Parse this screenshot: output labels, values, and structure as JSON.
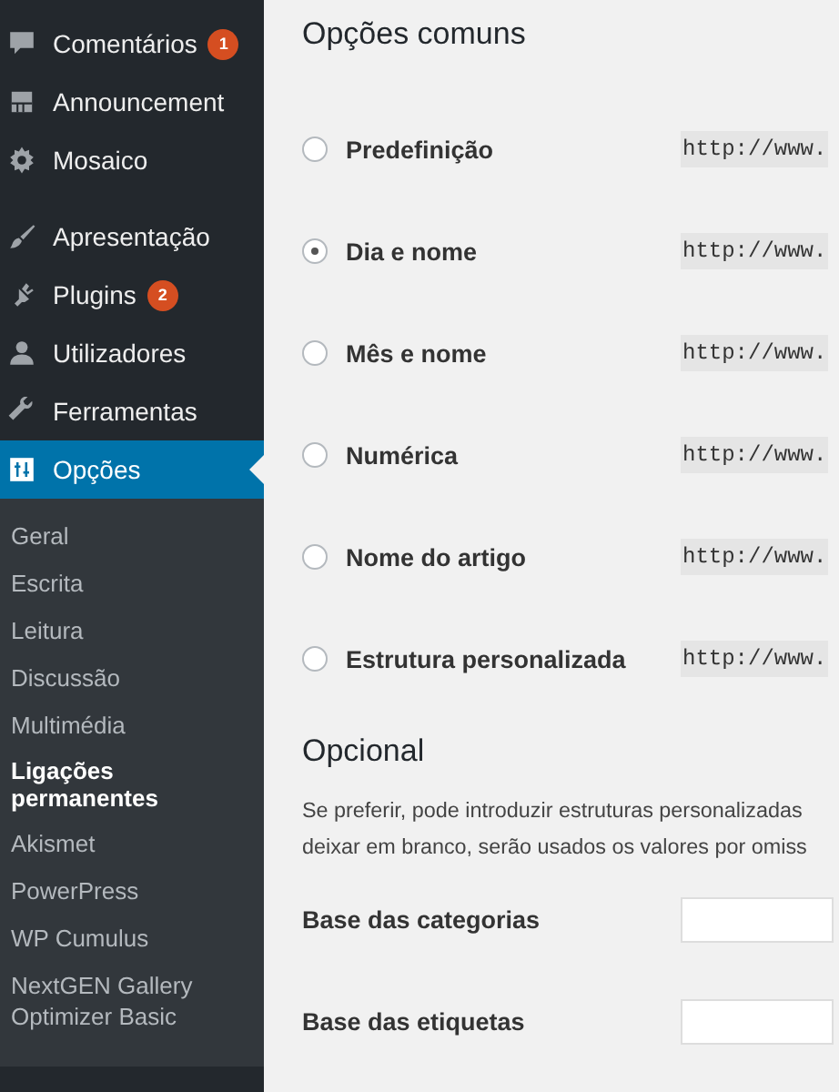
{
  "sidebar": {
    "menu": [
      {
        "label": "Comentários",
        "badge": "1",
        "selected": false
      },
      {
        "label": "Announcement",
        "selected": false
      },
      {
        "label": "Mosaico",
        "selected": false
      },
      {
        "label": "Apresentação",
        "selected": false
      },
      {
        "label": "Plugins",
        "badge": "2",
        "selected": false
      },
      {
        "label": "Utilizadores",
        "selected": false
      },
      {
        "label": "Ferramentas",
        "selected": false
      },
      {
        "label": "Opções",
        "selected": true
      }
    ],
    "submenu": [
      {
        "label": "Geral",
        "selected": false
      },
      {
        "label": "Escrita",
        "selected": false
      },
      {
        "label": "Leitura",
        "selected": false
      },
      {
        "label": "Discussão",
        "selected": false
      },
      {
        "label": "Multimédia",
        "selected": false
      },
      {
        "label": "Ligações permanentes",
        "selected": true
      },
      {
        "label": "Akismet",
        "selected": false
      },
      {
        "label": "PowerPress",
        "selected": false
      },
      {
        "label": "WP Cumulus",
        "selected": false
      },
      {
        "label": "NextGEN Gallery Optimizer Basic",
        "selected": false
      }
    ]
  },
  "main": {
    "common": {
      "heading": "Opções comuns",
      "options": [
        {
          "label": "Predefinição",
          "selected": false,
          "example": "http://www."
        },
        {
          "label": "Dia e nome",
          "selected": true,
          "example": "http://www."
        },
        {
          "label": "Mês e nome",
          "selected": false,
          "example": "http://www."
        },
        {
          "label": "Numérica",
          "selected": false,
          "example": "http://www."
        },
        {
          "label": "Nome do artigo",
          "selected": false,
          "example": "http://www."
        },
        {
          "label": "Estrutura personalizada",
          "selected": false,
          "example": "http://www."
        }
      ]
    },
    "optional": {
      "heading": "Opcional",
      "description_lines": [
        "Se preferir, pode introduzir estruturas personalizadas",
        "deixar em branco, serão usados os valores por omiss"
      ],
      "fields": [
        {
          "label": "Base das categorias"
        },
        {
          "label": "Base das etiquetas"
        }
      ]
    }
  }
}
